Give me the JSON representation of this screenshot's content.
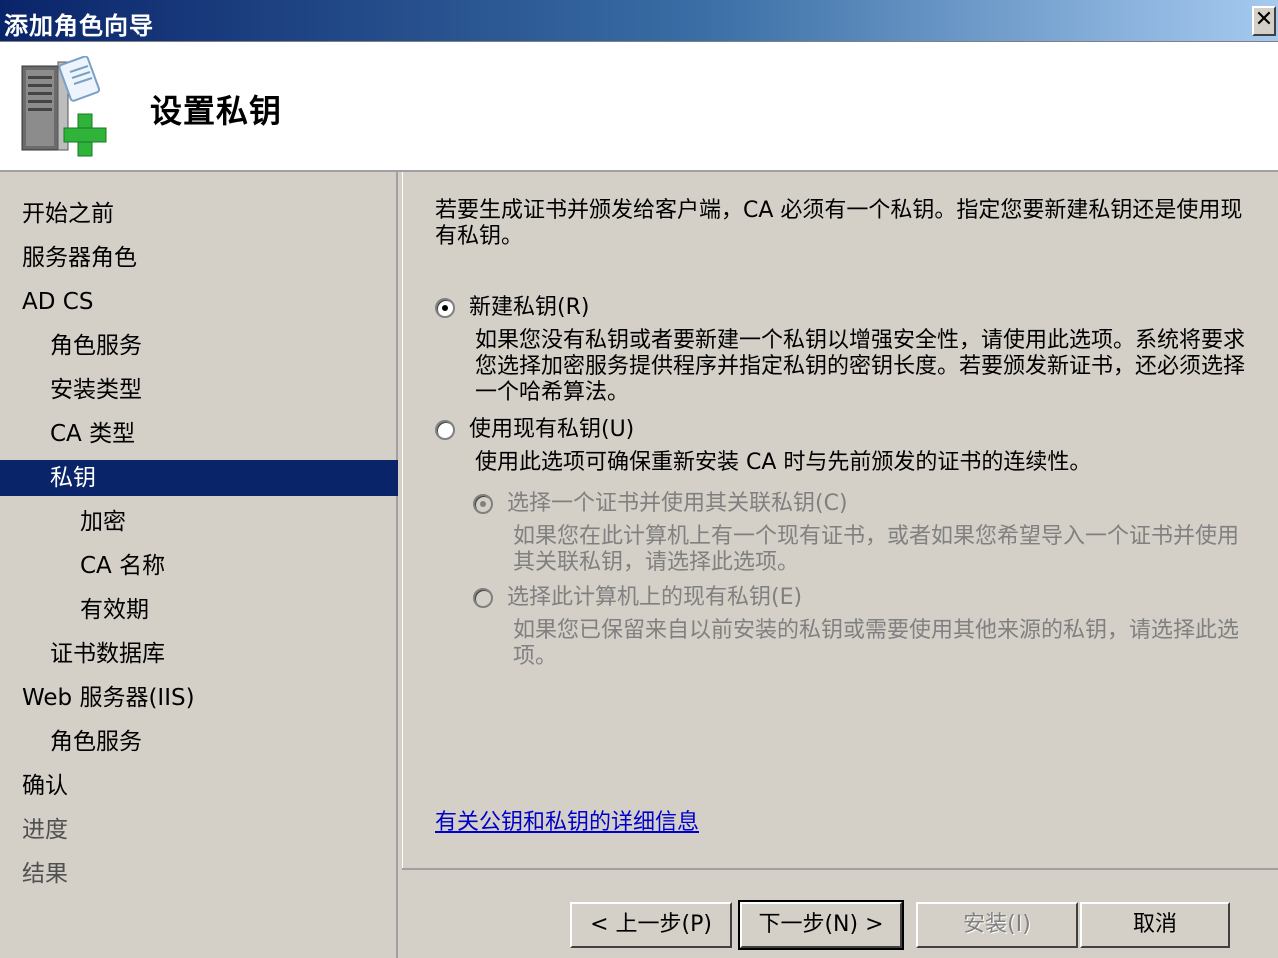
{
  "window": {
    "title": "添加角色向导",
    "close_label": "✕"
  },
  "header": {
    "page_title": "设置私钥",
    "icon": "server-with-add-icon"
  },
  "sidebar": {
    "items": [
      {
        "label": "开始之前",
        "state": "normal"
      },
      {
        "label": "服务器角色",
        "state": "normal"
      },
      {
        "label": "AD CS",
        "state": "normal"
      },
      {
        "label": "角色服务",
        "state": "normal"
      },
      {
        "label": "安装类型",
        "state": "normal"
      },
      {
        "label": "CA 类型",
        "state": "normal"
      },
      {
        "label": "私钥",
        "state": "selected"
      },
      {
        "label": "加密",
        "state": "normal"
      },
      {
        "label": "CA 名称",
        "state": "normal"
      },
      {
        "label": "有效期",
        "state": "normal"
      },
      {
        "label": "证书数据库",
        "state": "normal"
      },
      {
        "label": "Web 服务器(IIS)",
        "state": "normal"
      },
      {
        "label": "角色服务",
        "state": "normal"
      },
      {
        "label": "确认",
        "state": "normal"
      },
      {
        "label": "进度",
        "state": "disabled"
      },
      {
        "label": "结果",
        "state": "disabled"
      }
    ]
  },
  "content": {
    "intro": "若要生成证书并颁发给客户端，CA 必须有一个私钥。指定您要新建私钥还是使用现有私钥。",
    "option_new": {
      "label": "新建私钥(R)",
      "checked": true,
      "description": "如果您没有私钥或者要新建一个私钥以增强安全性，请使用此选项。系统将要求您选择加密服务提供程序并指定私钥的密钥长度。若要颁发新证书，还必须选择一个哈希算法。"
    },
    "option_existing": {
      "label": "使用现有私钥(U)",
      "checked": false,
      "description": "使用此选项可确保重新安装 CA 时与先前颁发的证书的连续性。"
    },
    "sub_option_cert": {
      "label": "选择一个证书并使用其关联私钥(C)",
      "checked": true,
      "disabled": true,
      "description": "如果您在此计算机上有一个现有证书，或者如果您希望导入一个证书并使用其关联私钥，请选择此选项。"
    },
    "sub_option_key": {
      "label": "选择此计算机上的现有私钥(E)",
      "checked": false,
      "disabled": true,
      "description": "如果您已保留来自以前安装的私钥或需要使用其他来源的私钥，请选择此选项。"
    },
    "detail_link": "有关公钥和私钥的详细信息"
  },
  "footer": {
    "back": "< 上一步(P)",
    "next": "下一步(N) >",
    "install": "安装(I)",
    "cancel": "取消"
  },
  "colors": {
    "selection": "#0a246a",
    "link": "#0000cc",
    "dialog_bg": "#d4d0c8",
    "disabled_text": "#808080"
  }
}
